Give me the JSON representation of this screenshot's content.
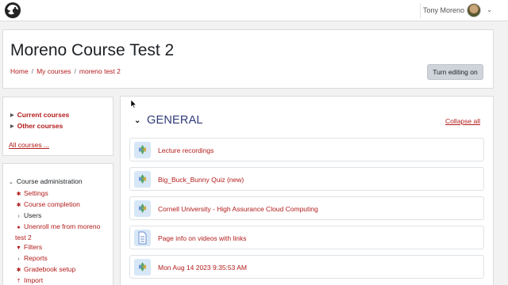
{
  "topbar": {
    "user_name": "Tony Moreno",
    "user_caret": "⌄"
  },
  "header": {
    "title": "Moreno Course Test 2",
    "breadcrumb": [
      "Home",
      "My courses",
      "moreno test 2"
    ],
    "edit_button": "Turn editing on"
  },
  "navigation": {
    "items": [
      "Current courses",
      "Other courses"
    ],
    "all_courses": "All courses ..."
  },
  "administration": {
    "title": "Course administration",
    "items": [
      {
        "label": "Settings",
        "icon": "gear-icon"
      },
      {
        "label": "Course completion",
        "icon": "gear-icon"
      },
      {
        "label": "Users",
        "icon": "chevron-right-icon"
      },
      {
        "label": "Unenroll me from moreno test 2",
        "icon": "user-icon"
      },
      {
        "label": "Filters",
        "icon": "filter-icon"
      },
      {
        "label": "Reports",
        "icon": "chevron-right-icon"
      },
      {
        "label": "Gradebook setup",
        "icon": "gear-icon"
      },
      {
        "label": "Import",
        "icon": "import-icon"
      }
    ]
  },
  "section": {
    "title": "GENERAL",
    "collapse_all": "Collapse all"
  },
  "activities": [
    {
      "label": "Lecture recordings",
      "icon": "external-tool-icon"
    },
    {
      "label": "Big_Buck_Bunny Quiz (new)",
      "icon": "external-tool-icon"
    },
    {
      "label": "Cornell University - High Assurance Cloud Computing",
      "icon": "external-tool-icon"
    },
    {
      "label": "Page info on videos with links",
      "icon": "page-icon"
    },
    {
      "label": "Mon Aug 14 2023 9:35:53 AM",
      "icon": "external-tool-icon"
    }
  ],
  "colors": {
    "link": "#b31b1b",
    "section_title": "#2f3a77",
    "button_bg": "#ced4da",
    "icon_bg": "#d7e7f7"
  }
}
